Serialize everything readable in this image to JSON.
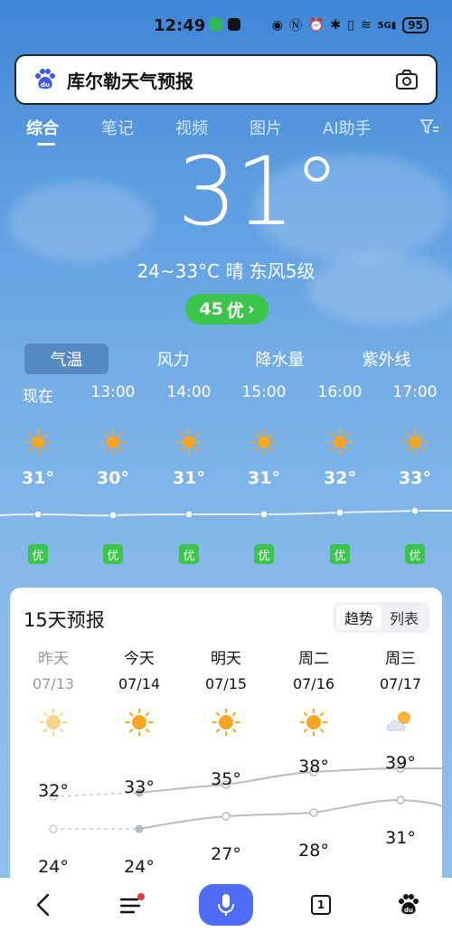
{
  "status": {
    "time": "12:49",
    "network": "5G",
    "battery": "95"
  },
  "search": {
    "query": "库尔勒天气预报",
    "logo_icon": "baidu-paw-icon",
    "camera_icon": "camera-icon"
  },
  "tabs": [
    {
      "label": "综合",
      "active": true
    },
    {
      "label": "笔记"
    },
    {
      "label": "视频"
    },
    {
      "label": "图片"
    },
    {
      "label": "AI助手"
    }
  ],
  "weather": {
    "temp": "31°",
    "condition": "24~33°C 晴 东风5级",
    "aqi_value": "45",
    "aqi_level": "优",
    "aqi_arrow": "›"
  },
  "subtabs": [
    "气温",
    "风力",
    "降水量",
    "紫外线"
  ],
  "hourly": [
    {
      "time": "现在",
      "temp": "31°",
      "aqi": "优"
    },
    {
      "time": "13:00",
      "temp": "30°",
      "aqi": "优"
    },
    {
      "time": "14:00",
      "temp": "31°",
      "aqi": "优"
    },
    {
      "time": "15:00",
      "temp": "31°",
      "aqi": "优"
    },
    {
      "time": "16:00",
      "temp": "32°",
      "aqi": "优"
    },
    {
      "time": "17:00",
      "temp": "33°",
      "aqi": "优"
    }
  ],
  "forecast": {
    "title": "15天预报",
    "toggle": [
      "趋势",
      "列表"
    ],
    "days": [
      {
        "name": "昨天",
        "date": "07/13",
        "icon": "sunny-icon",
        "high": "32°",
        "low": "24°"
      },
      {
        "name": "今天",
        "date": "07/14",
        "icon": "sunny-icon",
        "high": "33°",
        "low": "24°"
      },
      {
        "name": "明天",
        "date": "07/15",
        "icon": "sunny-icon",
        "high": "35°",
        "low": "27°"
      },
      {
        "name": "周二",
        "date": "07/16",
        "icon": "sunny-icon",
        "high": "38°",
        "low": "28°"
      },
      {
        "name": "周三",
        "date": "07/17",
        "icon": "partly-cloudy-icon",
        "high": "39°",
        "low": "31°"
      }
    ]
  },
  "bottom_nav": {
    "tab_count": "1"
  },
  "colors": {
    "aqi_good": "#3bc54a",
    "mic_button": "#4e6cf5",
    "sun": "#f6a623"
  }
}
